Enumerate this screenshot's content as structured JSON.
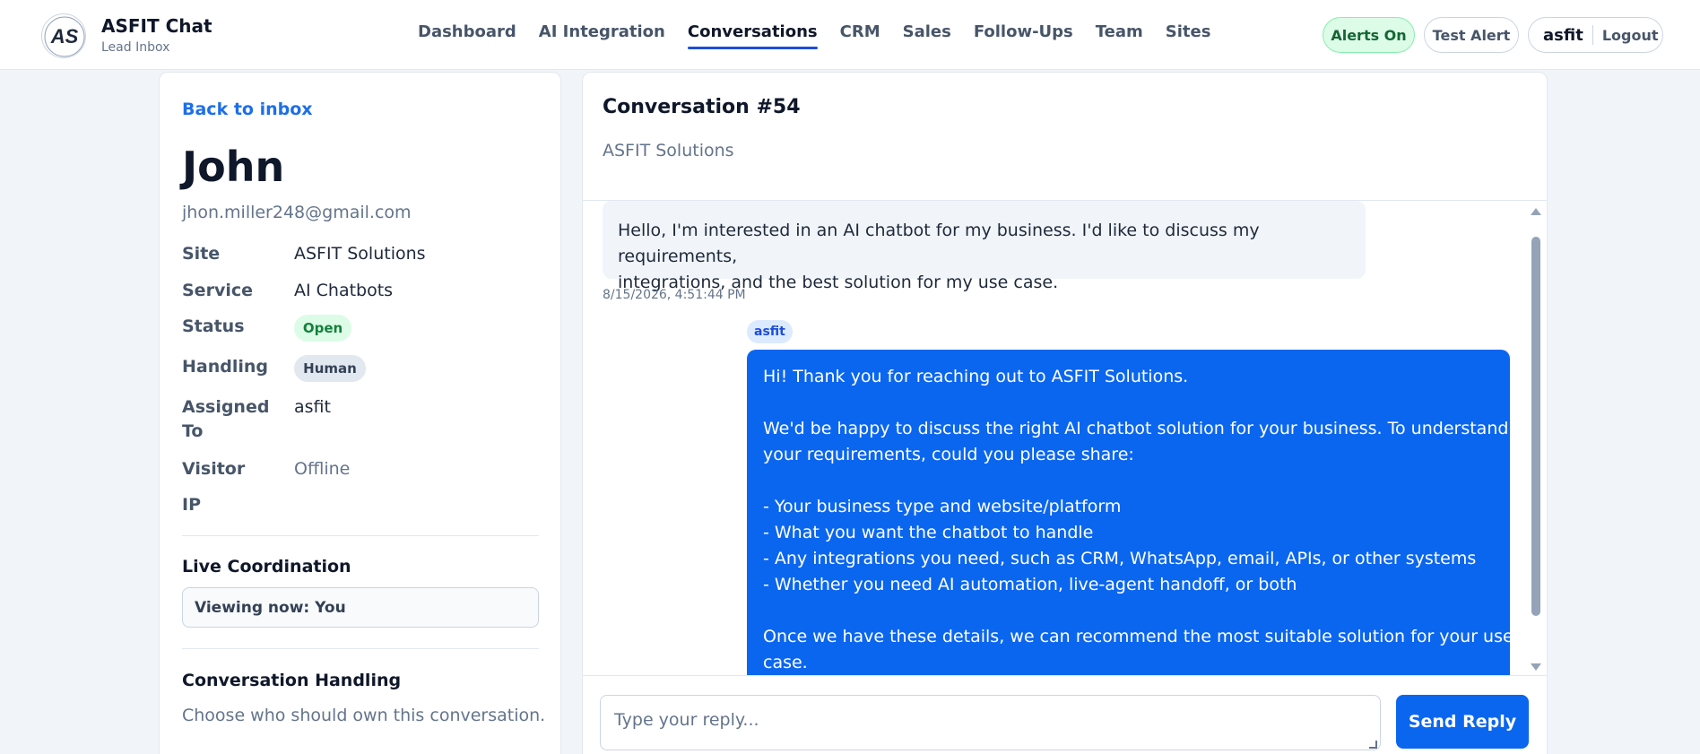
{
  "app": {
    "title": "ASFIT Chat",
    "subtitle": "Lead Inbox",
    "logo_text": "AS"
  },
  "nav": {
    "items": [
      {
        "label": "Dashboard",
        "active": false
      },
      {
        "label": "AI Integration",
        "active": false
      },
      {
        "label": "Conversations",
        "active": true
      },
      {
        "label": "CRM",
        "active": false
      },
      {
        "label": "Sales",
        "active": false
      },
      {
        "label": "Follow-Ups",
        "active": false
      },
      {
        "label": "Team",
        "active": false
      },
      {
        "label": "Sites",
        "active": false
      }
    ]
  },
  "header_actions": {
    "alerts_label": "Alerts On",
    "test_alert_label": "Test Alert",
    "username": "asfit",
    "logout_label": "Logout"
  },
  "contact": {
    "back_label": "Back to inbox",
    "name": "John",
    "email": "jhon.miller248@gmail.com",
    "fields": {
      "site_label": "Site",
      "site_value": "ASFIT Solutions",
      "service_label": "Service",
      "service_value": "AI Chatbots",
      "status_label": "Status",
      "status_value": "Open",
      "handling_label": "Handling",
      "handling_value": "Human",
      "assigned_label_line1": "Assigned",
      "assigned_label_line2": "To",
      "assigned_value": "asfit",
      "visitor_label": "Visitor",
      "visitor_value": "Offline",
      "ip_label": "IP"
    },
    "live_coordination": {
      "title": "Live Coordination",
      "viewing": "Viewing now: You"
    },
    "conversation_handling": {
      "title": "Conversation Handling",
      "description": "Choose who should own this conversation."
    }
  },
  "conversation": {
    "title": "Conversation #54",
    "site": "ASFIT Solutions",
    "messages": [
      {
        "direction": "in",
        "lines": [
          "Hello, I'm interested in an AI chatbot for my business. I'd like to discuss my requirements,",
          "integrations, and the best solution for my use case."
        ],
        "timestamp": "8/15/2026, 4:51:44 PM"
      },
      {
        "direction": "out",
        "sender": "asfit",
        "lines": [
          "Hi! Thank you for reaching out to ASFIT Solutions.",
          "",
          "We'd be happy to discuss the right AI chatbot solution for your business. To understand",
          "your requirements, could you please share:",
          "",
          "- Your business type and website/platform",
          "- What you want the chatbot to handle",
          "- Any integrations you need, such as CRM, WhatsApp, email, APIs, or other systems",
          "- Whether you need AI automation, live-agent handoff, or both",
          "",
          "Once we have these details, we can recommend the most suitable solution for your use",
          "case."
        ]
      }
    ],
    "reply_placeholder": "Type your reply...",
    "send_label": "Send Reply"
  }
}
